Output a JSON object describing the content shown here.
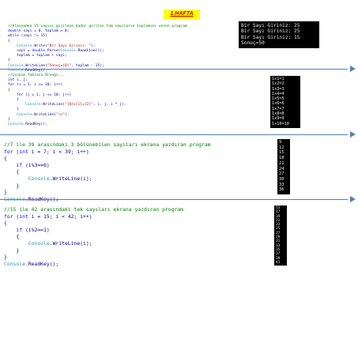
{
  "page": {
    "title": "1.HAFTA"
  },
  "sections": [
    {
      "code_lines": [
        "//klavyeden 15 sayısı girilene kadar girilen tüm sayıların toplamını veren program",
        "double sayi = 0, toplam = 0;",
        "while (sayi != 15)",
        "{",
        "    Console.Write(\"Bir Sayı Giriniz: \");",
        "    sayi = double.Parse(Console.ReadLine());",
        "    toplam = toplam + sayi;",
        "}",
        "Console.WriteLine(\"Sonuç={0}\", toplam - 15);",
        "Console.ReadKey();"
      ],
      "output_lines": [
        "Bir Sayı Giriniz: 25",
        "Bir Sayı Giriniz: 25",
        "Bir Sayı Giriniz: 15",
        "Sonuç=50"
      ]
    },
    {
      "code_lines": [
        "//Çarpım Tablosu Örneği...",
        "int i, j;",
        "for (i = 1; i <= 10; i++)",
        "{",
        "    for (j = 1; j <= 10; j++)",
        "    {",
        "        Console.WriteLine(\"{0}x{1}={2}\", i, j, i * j);",
        "    }",
        "    Console.WriteLine(\"\\n\");",
        "}",
        "Console.ReadKey();"
      ],
      "output_lines": [
        "1x1=1",
        "1x2=2",
        "1x3=3",
        "1x4=4",
        "1x5=5",
        "1x6=6",
        "1x7=7",
        "1x8=8",
        "1x9=9",
        "1x10=10"
      ]
    },
    {
      "code_lines": [
        "//7 ile 39 arasındaki 3 bölünebilen sayıları ekrana yazdıran program",
        "for (int i = 7; i < 39; i++)",
        "{",
        "    if (i%3==0)",
        "    {",
        "        Console.WriteLine(i);",
        "    }",
        "}",
        "Console.ReadKey();"
      ],
      "output_lines": [
        "9",
        "12",
        "15",
        "18",
        "21",
        "24",
        "27",
        "30",
        "33",
        "36"
      ]
    },
    {
      "code_lines": [
        "//15 ile 42 arasındaki tek sayıları ekrana yazdıran program",
        "for (int i = 15; i < 42; i++)",
        "{",
        "    if (i%2==1)",
        "    {",
        "        Console.WriteLine(i);",
        "    }",
        "}",
        "Console.ReadKey();"
      ],
      "output_lines": [
        "15",
        "17",
        "19",
        "21",
        "23",
        "25",
        "27",
        "29",
        "31",
        "33",
        "35",
        "37",
        "39",
        "41"
      ]
    }
  ],
  "colors": {
    "comment": "#008000",
    "keyword": "#0000ff",
    "class": "#2b91af",
    "string": "#a31515",
    "text": "#000080",
    "separator": "#4f81bd",
    "title_bg": "#ffff00",
    "title_fg": "#c00000"
  }
}
